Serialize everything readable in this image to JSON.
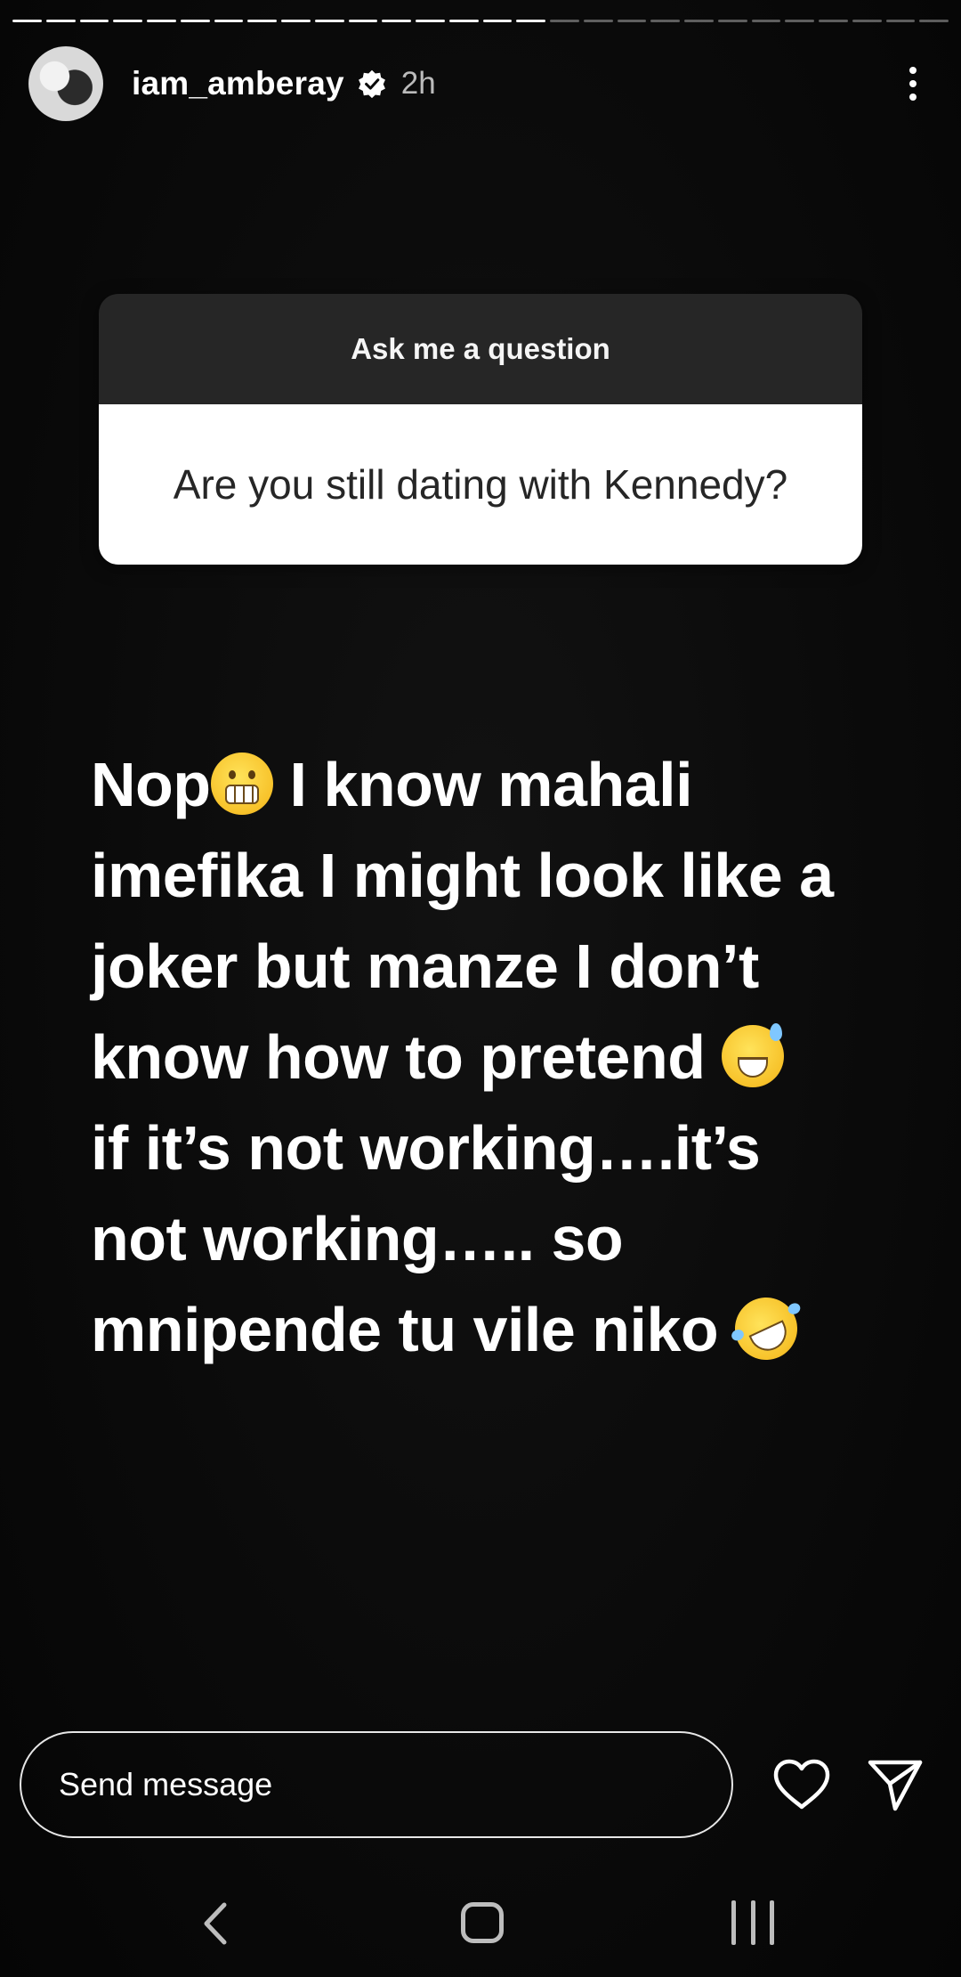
{
  "progress": {
    "segments_total": 28,
    "segments_viewed": 16
  },
  "header": {
    "username": "iam_amberay",
    "verified": true,
    "time_ago": "2h"
  },
  "question_sticker": {
    "title": "Ask me a question",
    "question": "Are you still dating with Kennedy?"
  },
  "answer": {
    "lines": [
      "Nop",
      " I know mahali",
      "imefika I might look like a",
      "joker but manze I don’t",
      "know how to pretend ",
      "if it’s not working….it’s",
      "not working….. so",
      "mnipende tu vile niko "
    ],
    "emojis": [
      "grimacing-face",
      "grinning-face-with-sweat",
      "rolling-on-the-floor-laughing"
    ]
  },
  "footer": {
    "message_placeholder": "Send message"
  },
  "colors": {
    "background": "#0a0a0a",
    "card_header": "#262626",
    "card_body": "#ffffff",
    "text": "#ffffff"
  }
}
